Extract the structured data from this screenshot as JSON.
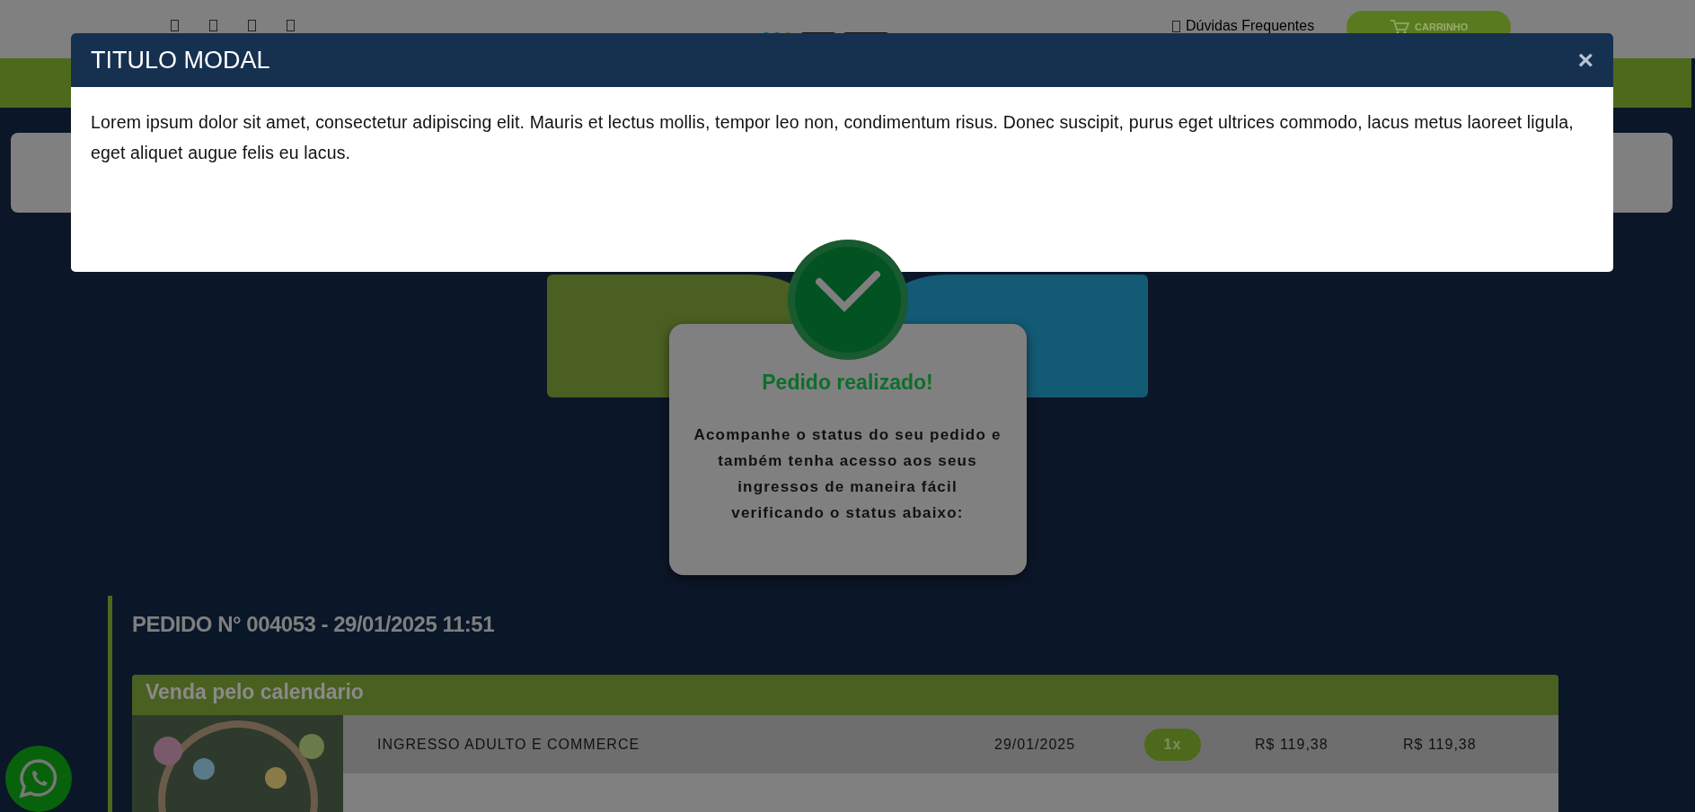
{
  "header": {
    "faq_label": "Dúvidas Frequentes",
    "cart_label": "CARRINHO"
  },
  "modal": {
    "title": "TITULO MODAL",
    "close": "×",
    "body": "Lorem ipsum dolor sit amet, consectetur adipiscing elit. Mauris et lectus mollis, tempor leo non, condimentum risus. Donec suscipit, purus eget ultrices commodo, lacus metus laoreet ligula, eget aliquet augue felis eu lacus."
  },
  "success": {
    "title": "Pedido realizado!",
    "message": "Acompanhe o status do seu pedido e também tenha acesso aos seus ingressos de maneira fácil verificando o status abaixo:"
  },
  "order": {
    "title": "PEDIDO N° 004053 - 29/01/2025 11:51",
    "group": {
      "title": "Venda pelo calendario",
      "items": [
        {
          "kind": "picture",
          "name": "INGRESSO ADULTO E COMMERCE",
          "date": "29/01/2025",
          "quantity": "1x",
          "price": "R$ 119,38",
          "total": "R$ 119,38"
        }
      ]
    }
  }
}
